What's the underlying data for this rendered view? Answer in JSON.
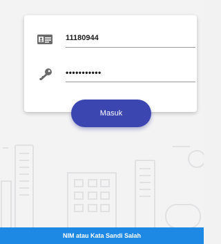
{
  "login_form": {
    "nim_value": "11180944",
    "password_masked": "•••••••••••",
    "nim_icon": "id-card-icon",
    "password_icon": "key-icon"
  },
  "actions": {
    "login_label": "Masuk"
  },
  "snackbar": {
    "message": "NIM atau Kata Sandi Salah"
  },
  "colors": {
    "primary_button": "#3b46b0",
    "snackbar": "#1e88e5",
    "background": "#f3f3f4"
  }
}
